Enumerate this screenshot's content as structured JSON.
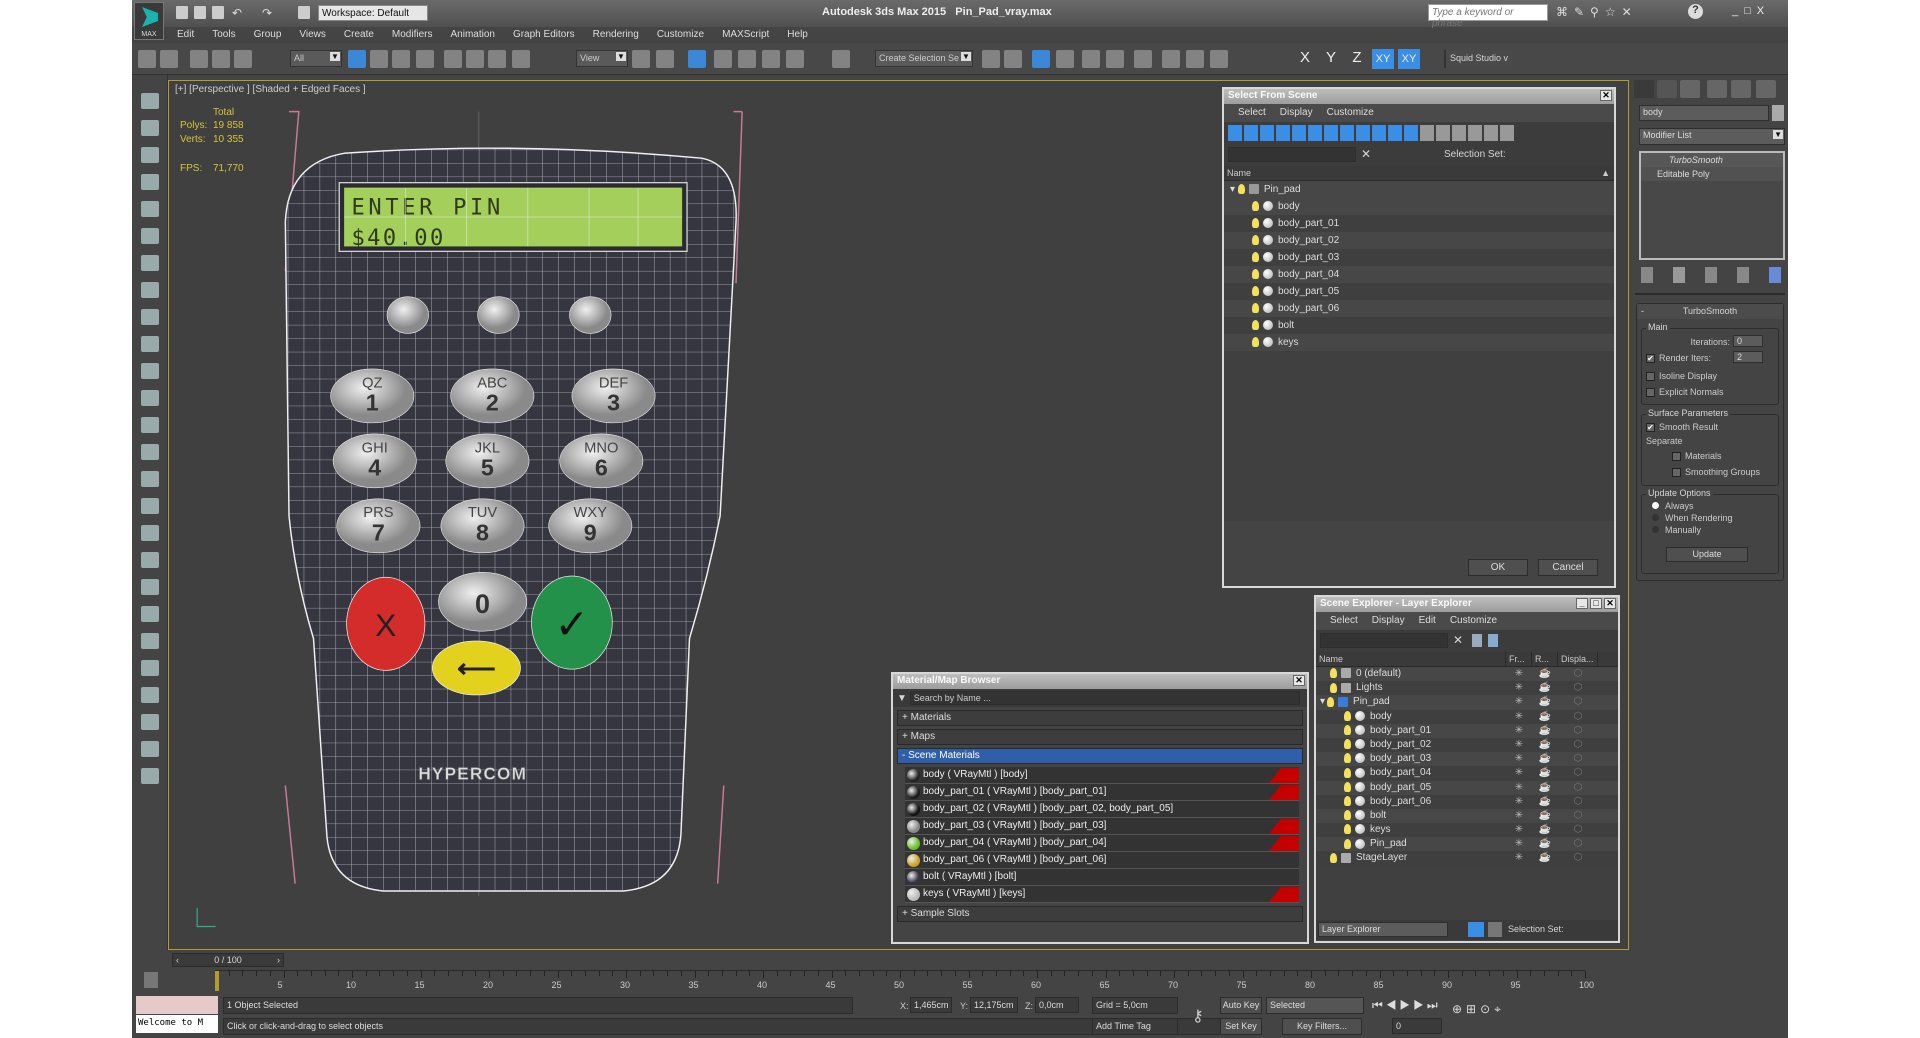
{
  "title": {
    "app": "Autodesk 3ds Max  2015",
    "file": "Pin_Pad_vray.max",
    "logo_text": "MAX",
    "workspace": "Workspace: Default",
    "search_placeholder": "Type a keyword or phrase"
  },
  "menu": [
    "Edit",
    "Tools",
    "Group",
    "Views",
    "Create",
    "Modifiers",
    "Animation",
    "Graph Editors",
    "Rendering",
    "Customize",
    "MAXScript",
    "Help"
  ],
  "toolbar": {
    "selection_filter": "All",
    "ref_coord": "View",
    "named_selection": "Create Selection Se",
    "axes": [
      "X",
      "Y",
      "Z",
      "XY",
      "XY"
    ],
    "workspace_label": "Squid Studio v"
  },
  "viewport": {
    "label": "[+] [Perspective ] [Shaded + Edged Faces ]",
    "stats": {
      "total": "Total",
      "polys_label": "Polys:",
      "polys": "19 858",
      "verts_label": "Verts:",
      "verts": "10 355",
      "fps_label": "FPS:",
      "fps": "71,770"
    }
  },
  "model": {
    "lcd_line1": "ENTER PIN",
    "lcd_line2": "$40.00",
    "keys": [
      {
        "letters": "QZ",
        "digit": "1"
      },
      {
        "letters": "ABC",
        "digit": "2"
      },
      {
        "letters": "DEF",
        "digit": "3"
      },
      {
        "letters": "GHI",
        "digit": "4"
      },
      {
        "letters": "JKL",
        "digit": "5"
      },
      {
        "letters": "MNO",
        "digit": "6"
      },
      {
        "letters": "PRS",
        "digit": "7"
      },
      {
        "letters": "TUV",
        "digit": "8"
      },
      {
        "letters": "WXY",
        "digit": "9"
      }
    ],
    "zero": "0",
    "cancel": "X",
    "enter": "✓",
    "clear": "⟵",
    "logo": "HYPERCOM"
  },
  "select_from_scene": {
    "title": "Select From Scene",
    "menu": [
      "Select",
      "Display",
      "Customize"
    ],
    "selection_set_label": "Selection Set:",
    "column": "Name",
    "root": "Pin_pad",
    "items": [
      "body",
      "body_part_01",
      "body_part_02",
      "body_part_03",
      "body_part_04",
      "body_part_05",
      "body_part_06",
      "bolt",
      "keys"
    ],
    "ok": "OK",
    "cancel": "Cancel"
  },
  "command_panel": {
    "object_name": "body",
    "modifier_list": "Modifier List",
    "stack": [
      "TurboSmooth",
      "Editable Poly"
    ],
    "rollout": "TurboSmooth",
    "main_group": "Main",
    "iterations_label": "Iterations:",
    "iterations": "0",
    "render_iters_label": "Render Iters:",
    "render_iters": "2",
    "render_iters_checked": true,
    "isoline": "Isoline Display",
    "explicit": "Explicit Normals",
    "surface_group": "Surface Parameters",
    "smooth_result": "Smooth Result",
    "separate": "Separate",
    "materials": "Materials",
    "smoothing_groups": "Smoothing Groups",
    "update_group": "Update Options",
    "update_options": [
      "Always",
      "When Rendering",
      "Manually"
    ],
    "update_selected": "Always",
    "update_button": "Update"
  },
  "material_browser": {
    "title": "Material/Map Browser",
    "search_placeholder": "Search by Name ...",
    "sections": [
      "+ Materials",
      "+ Maps"
    ],
    "scene_section": "- Scene Materials",
    "materials": [
      {
        "label": "body  ( VRayMtl ) [body]",
        "swatch": "#222",
        "flag": true
      },
      {
        "label": "body_part_01  ( VRayMtl ) [body_part_01]",
        "swatch": "#1a1a1a",
        "flag": true
      },
      {
        "label": "body_part_02  ( VRayMtl ) [body_part_02, body_part_05]",
        "swatch": "#111",
        "flag": false
      },
      {
        "label": "body_part_03  ( VRayMtl ) [body_part_03]",
        "swatch": "#888",
        "flag": true
      },
      {
        "label": "body_part_04  ( VRayMtl ) [body_part_04]",
        "swatch": "#6cbf2a",
        "flag": true
      },
      {
        "label": "body_part_06  ( VRayMtl ) [body_part_06]",
        "swatch": "#c9a227",
        "flag": false
      },
      {
        "label": "bolt  ( VRayMtl ) [bolt]",
        "swatch": "#334",
        "flag": false
      },
      {
        "label": "keys  ( VRayMtl ) [keys]",
        "swatch": "#bbb",
        "flag": true
      }
    ],
    "sample_slots": "+ Sample Slots"
  },
  "scene_explorer": {
    "title": "Scene Explorer - Layer Explorer",
    "menu": [
      "Select",
      "Display",
      "Edit",
      "Customize"
    ],
    "columns": [
      "Name",
      "Fr...",
      "R...",
      "Displa..."
    ],
    "rows": [
      {
        "name": "0 (default)",
        "level": 0,
        "type": "layer"
      },
      {
        "name": "Lights",
        "level": 0,
        "type": "layer"
      },
      {
        "name": "Pin_pad",
        "level": 0,
        "type": "layer-open"
      },
      {
        "name": "body",
        "level": 1,
        "type": "object"
      },
      {
        "name": "body_part_01",
        "level": 1,
        "type": "object"
      },
      {
        "name": "body_part_02",
        "level": 1,
        "type": "object"
      },
      {
        "name": "body_part_03",
        "level": 1,
        "type": "object"
      },
      {
        "name": "body_part_04",
        "level": 1,
        "type": "object"
      },
      {
        "name": "body_part_05",
        "level": 1,
        "type": "object"
      },
      {
        "name": "body_part_06",
        "level": 1,
        "type": "object"
      },
      {
        "name": "bolt",
        "level": 1,
        "type": "object"
      },
      {
        "name": "keys",
        "level": 1,
        "type": "object"
      },
      {
        "name": "Pin_pad",
        "level": 1,
        "type": "group"
      },
      {
        "name": "StageLayer",
        "level": 0,
        "type": "layer"
      }
    ],
    "mode": "Layer Explorer",
    "selection_set": "Selection Set:"
  },
  "timeline": {
    "frame": "0 / 100",
    "tick_labels": [
      "5",
      "10",
      "15",
      "20",
      "25",
      "30",
      "35",
      "40",
      "45",
      "50",
      "55",
      "60",
      "65",
      "70",
      "75",
      "80",
      "85",
      "90",
      "95",
      "100"
    ]
  },
  "status": {
    "maxscript": "Welcome to M",
    "selected": "1 Object Selected",
    "prompt": "Click or click-and-drag to select objects",
    "x_label": "X:",
    "x": "1,465cm",
    "y_label": "Y:",
    "y": "12,175cm",
    "z_label": "Z:",
    "z": "0,0cm",
    "grid": "Grid = 5,0cm",
    "add_time_tag": "Add Time Tag",
    "auto_key": "Auto Key",
    "set_key": "Set Key",
    "key_mode": "Selected",
    "key_filters": "Key Filters...",
    "current_frame": "0"
  }
}
